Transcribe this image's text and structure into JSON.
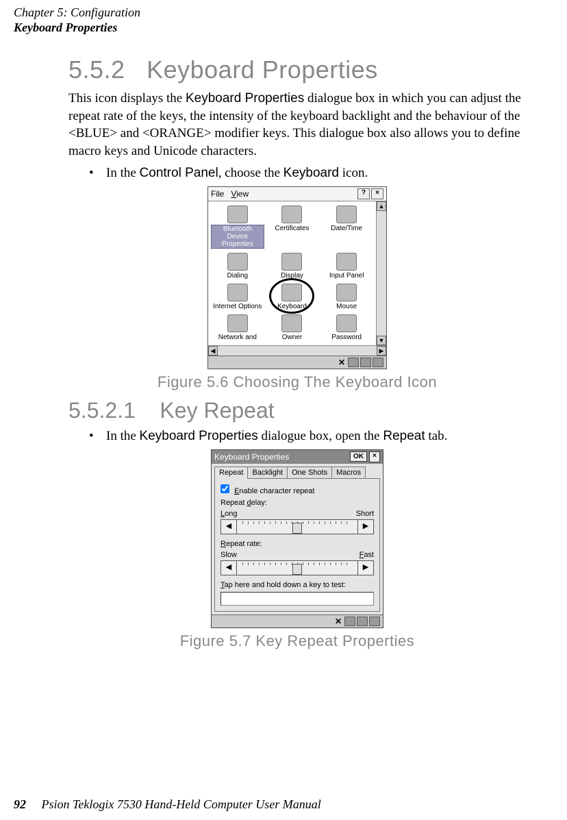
{
  "header": {
    "chapter": "Chapter 5: Configuration",
    "section": "Keyboard Properties"
  },
  "section_5_5_2": {
    "number": "5.5.2",
    "title": "Keyboard Properties",
    "para_pre": "This icon displays the ",
    "para_em": "Keyboard Properties",
    "para_post": " dialogue box in which you can adjust the repeat rate of the keys, the intensity of the keyboard backlight and the behaviour of the <BLUE> and <ORANGE> modifier keys. This dialogue box also allows you to define macro keys and Unicode characters.",
    "bullet_parts": [
      "In the ",
      "Control Panel",
      ", choose the ",
      "Keyboard",
      " icon."
    ]
  },
  "control_panel": {
    "menu": {
      "file": "File",
      "view": "View",
      "help": "?",
      "close": "×"
    },
    "items": [
      {
        "label": "Bluetooth Device Properties",
        "selected": true
      },
      {
        "label": "Certificates"
      },
      {
        "label": "Date/Time"
      },
      {
        "label": "Dialing"
      },
      {
        "label": "Display"
      },
      {
        "label": "Input Panel"
      },
      {
        "label": "Internet Options"
      },
      {
        "label": "Keyboard",
        "circled": true
      },
      {
        "label": "Mouse"
      },
      {
        "label": "Network and"
      },
      {
        "label": "Owner"
      },
      {
        "label": "Password"
      }
    ],
    "scroll": {
      "up": "▲",
      "down": "▼",
      "left": "◀",
      "right": "▶"
    }
  },
  "figure1_caption": "Figure 5.6 Choosing The Keyboard Icon",
  "section_5_5_2_1": {
    "number": "5.5.2.1",
    "title": "Key Repeat",
    "bullet_parts": [
      "In the ",
      "Keyboard Properties",
      " dialogue box, open the ",
      "Repeat",
      " tab."
    ]
  },
  "keyboard_dialog": {
    "title": "Keyboard Properties",
    "ok": "OK",
    "close": "×",
    "tabs": [
      "Repeat",
      "Backlight",
      "One Shots",
      "Macros"
    ],
    "active_tab": "Repeat",
    "enable_label": "Enable character repeat",
    "enable_checked": true,
    "delay": {
      "label": "Repeat delay:",
      "left": "Long",
      "right": "Short",
      "left_arrow": "◀",
      "right_arrow": "▶"
    },
    "rate": {
      "label": "Repeat rate:",
      "left": "Slow",
      "right": "Fast",
      "left_arrow": "◀",
      "right_arrow": "▶"
    },
    "test_label": "Tap here and hold down a key to test:"
  },
  "figure2_caption": "Figure 5.7 Key Repeat Properties",
  "footer": {
    "page": "92",
    "text": "Psion Teklogix 7530 Hand-Held Computer User Manual"
  }
}
